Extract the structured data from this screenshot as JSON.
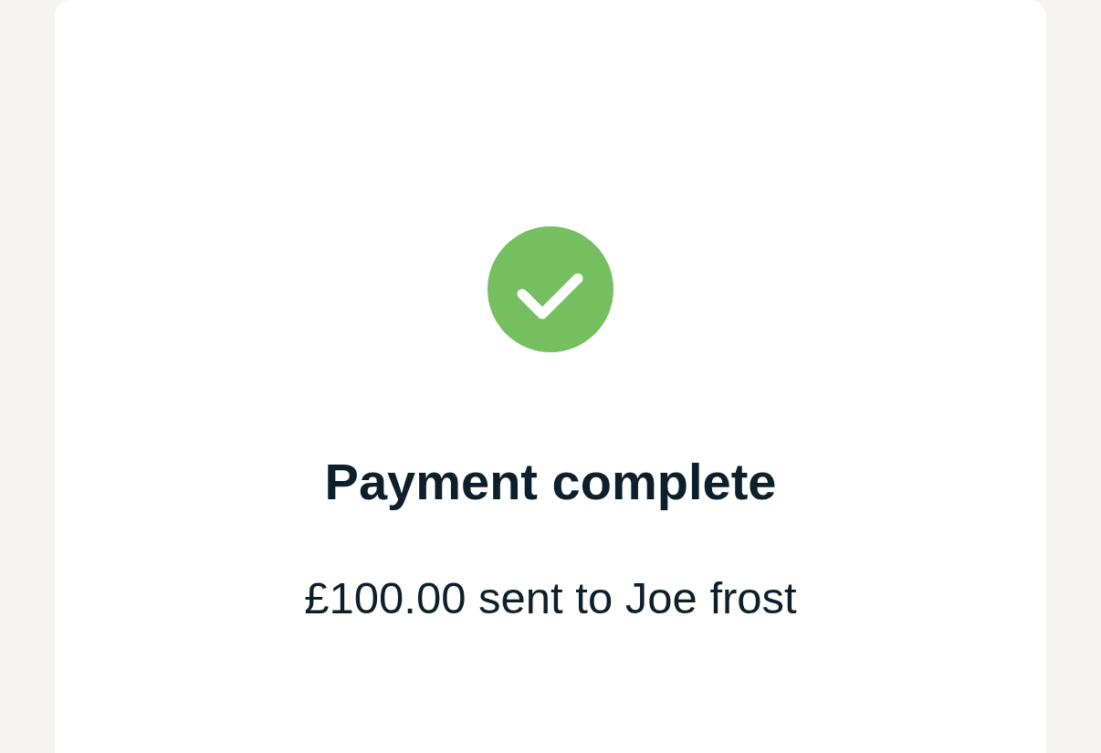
{
  "status": {
    "kind": "success"
  },
  "title": "Payment complete",
  "message": "£100.00 sent to Joe frost"
}
